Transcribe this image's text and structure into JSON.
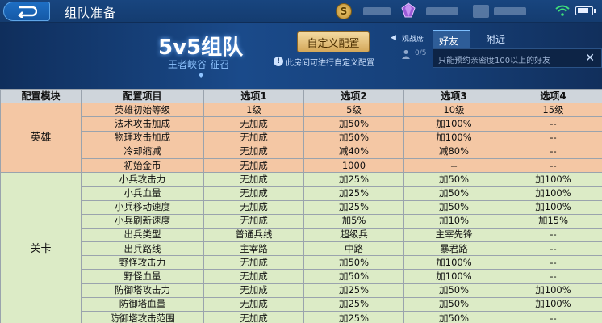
{
  "topbar": {
    "title": "组队准备",
    "coin_symbol": "S"
  },
  "header": {
    "mode_title": "5v5组队",
    "mode_subtitle": "王者峡谷-征召",
    "custom_button": "自定义配置",
    "info_text": "此房间可进行自定义配置",
    "spectator_label": "观战席",
    "spectator_count": "0/5",
    "tabs": [
      "好友",
      "附近"
    ],
    "friend_hint": "只能预约亲密度100以上的好友"
  },
  "table": {
    "headers": [
      "配置模块",
      "配置项目",
      "选项1",
      "选项2",
      "选项3",
      "选项4"
    ],
    "groups": [
      {
        "category": "英雄",
        "rows": [
          [
            "英雄初始等级",
            "1级",
            "5级",
            "10级",
            "15级"
          ],
          [
            "法术攻击加成",
            "无加成",
            "加50%",
            "加100%",
            "--"
          ],
          [
            "物理攻击加成",
            "无加成",
            "加50%",
            "加100%",
            "--"
          ],
          [
            "冷却缩减",
            "无加成",
            "减40%",
            "减80%",
            "--"
          ],
          [
            "初始金币",
            "无加成",
            "1000",
            "--",
            "--"
          ]
        ]
      },
      {
        "category": "关卡",
        "rows": [
          [
            "小兵攻击力",
            "无加成",
            "加25%",
            "加50%",
            "加100%"
          ],
          [
            "小兵血量",
            "无加成",
            "加25%",
            "加50%",
            "加100%"
          ],
          [
            "小兵移动速度",
            "无加成",
            "加25%",
            "加50%",
            "加100%"
          ],
          [
            "小兵刷新速度",
            "无加成",
            "加5%",
            "加10%",
            "加15%"
          ],
          [
            "出兵类型",
            "普通兵线",
            "超级兵",
            "主宰先锋",
            "--"
          ],
          [
            "出兵路线",
            "主宰路",
            "中路",
            "暴君路",
            "--"
          ],
          [
            "野怪攻击力",
            "无加成",
            "加50%",
            "加100%",
            "--"
          ],
          [
            "野怪血量",
            "无加成",
            "加50%",
            "加100%",
            "--"
          ],
          [
            "防御塔攻击力",
            "无加成",
            "加25%",
            "加50%",
            "加100%"
          ],
          [
            "防御塔血量",
            "无加成",
            "加25%",
            "加50%",
            "加100%"
          ],
          [
            "防御塔攻击范围",
            "无加成",
            "加25%",
            "加50%",
            "--"
          ]
        ]
      }
    ]
  },
  "colors": {
    "hero_row": "#f4c7a4",
    "stage_row": "#dcebc6",
    "header_row": "#cfd5db",
    "accent": "#7ec0ff"
  }
}
